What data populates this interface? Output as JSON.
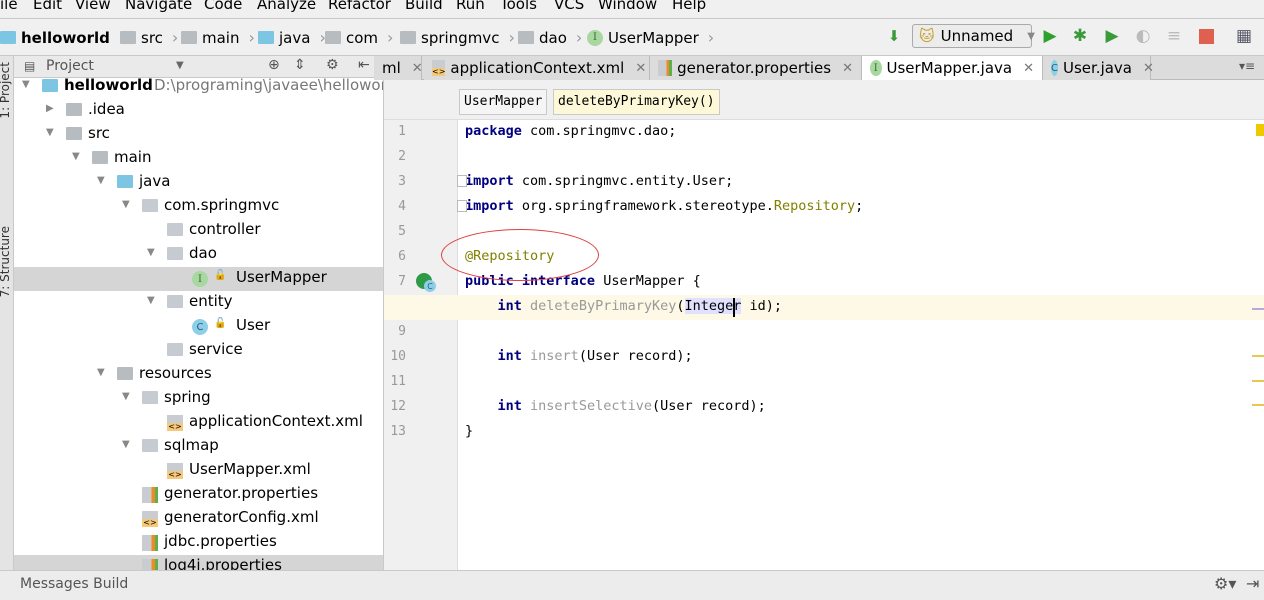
{
  "menu": [
    "ile",
    "Edit",
    "View",
    "Navigate",
    "Code",
    "Analyze",
    "Refactor",
    "Build",
    "Run",
    "Tools",
    "VCS",
    "Window",
    "Help"
  ],
  "breadcrumbs": [
    "helloworld",
    "src",
    "main",
    "java",
    "com",
    "springmvc",
    "dao",
    "UserMapper"
  ],
  "toolbar": {
    "run_config": "Unnamed",
    "binary_icon": "01\n10\n01"
  },
  "sidebar": {
    "project_label": "1: Project",
    "structure_label": "7: Structure"
  },
  "project_panel": {
    "title": "Project"
  },
  "tree": [
    {
      "label": "helloworld",
      "path": "D:\\programing\\javaee\\helloworld",
      "level": 0,
      "arrow": "down",
      "icon": "module",
      "bold": true
    },
    {
      "label": ".idea",
      "level": 1,
      "arrow": "right",
      "icon": "folder"
    },
    {
      "label": "src",
      "level": 1,
      "arrow": "down",
      "icon": "folder"
    },
    {
      "label": "main",
      "level": 2,
      "arrow": "down",
      "icon": "folder"
    },
    {
      "label": "java",
      "level": 3,
      "arrow": "down",
      "icon": "source-folder"
    },
    {
      "label": "com.springmvc",
      "level": 4,
      "arrow": "down",
      "icon": "package"
    },
    {
      "label": "controller",
      "level": 5,
      "icon": "package"
    },
    {
      "label": "dao",
      "level": 5,
      "arrow": "down",
      "icon": "package"
    },
    {
      "label": "UserMapper",
      "level": 6,
      "icon": "interface",
      "selected": true
    },
    {
      "label": "entity",
      "level": 5,
      "arrow": "down",
      "icon": "package"
    },
    {
      "label": "User",
      "level": 6,
      "icon": "class"
    },
    {
      "label": "service",
      "level": 5,
      "icon": "package"
    },
    {
      "label": "resources",
      "level": 3,
      "arrow": "down",
      "icon": "resources"
    },
    {
      "label": "spring",
      "level": 4,
      "arrow": "down",
      "icon": "package"
    },
    {
      "label": "applicationContext.xml",
      "level": 5,
      "icon": "spring-xml"
    },
    {
      "label": "sqlmap",
      "level": 4,
      "arrow": "down",
      "icon": "package"
    },
    {
      "label": "UserMapper.xml",
      "level": 5,
      "icon": "xml"
    },
    {
      "label": "generator.properties",
      "level": 4,
      "icon": "properties"
    },
    {
      "label": "generatorConfig.xml",
      "level": 4,
      "icon": "xml"
    },
    {
      "label": "jdbc.properties",
      "level": 4,
      "icon": "properties"
    },
    {
      "label": "log4j.properties",
      "level": 4,
      "icon": "properties",
      "highlighted": true
    }
  ],
  "tabs": [
    {
      "label": "ml",
      "icon": "none"
    },
    {
      "label": "applicationContext.xml",
      "icon": "spring-xml"
    },
    {
      "label": "generator.properties",
      "icon": "properties"
    },
    {
      "label": "UserMapper.java",
      "icon": "interface",
      "active": true
    },
    {
      "label": "User.java",
      "icon": "class"
    }
  ],
  "editor_breadcrumbs": [
    "UserMapper",
    "deleteByPrimaryKey()"
  ],
  "code": [
    [
      [
        "kw",
        "package"
      ],
      [
        "",
        "com.springmvc.dao;"
      ]
    ],
    [],
    [
      [
        "kw",
        "import"
      ],
      [
        "",
        "com.springmvc.entity.User;"
      ]
    ],
    [
      [
        "kw",
        "import"
      ],
      [
        "",
        "org.springframework.stereotype."
      ],
      [
        "cls",
        "Repository"
      ],
      [
        "",
        ";"
      ]
    ],
    [],
    [
      [
        "ann",
        "@Repository"
      ]
    ],
    [
      [
        "kw",
        "public interface"
      ],
      [
        "",
        "UserMapper {"
      ]
    ],
    [
      [
        "",
        ""
      ],
      [
        "kw",
        "int"
      ],
      [
        "mth",
        "deleteByPrimaryKey"
      ],
      [
        "",
        "("
      ],
      [
        "hl",
        "Integer"
      ],
      [
        "",
        " id);"
      ]
    ],
    [],
    [
      [
        "",
        ""
      ],
      [
        "kw",
        "int"
      ],
      [
        "mth",
        "insert"
      ],
      [
        "",
        "(User record);"
      ]
    ],
    [],
    [
      [
        "",
        ""
      ],
      [
        "kw",
        "int"
      ],
      [
        "mth",
        "insertSelective"
      ],
      [
        "",
        "(User record);"
      ]
    ],
    [
      [
        "",
        "}"
      ]
    ]
  ],
  "bottom": {
    "label": "Messages Build"
  },
  "colors": {
    "keyword": "#000080",
    "annotation": "#808000",
    "current_line": "#fdf9e6",
    "selection": "#d5d5d5"
  }
}
